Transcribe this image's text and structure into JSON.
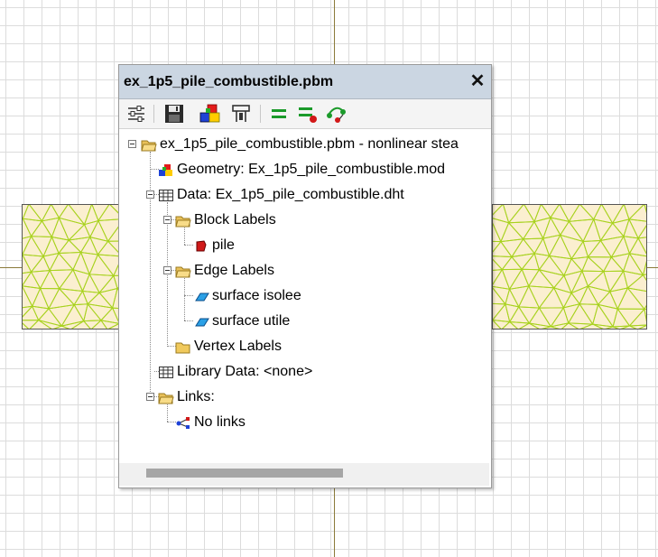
{
  "window": {
    "title": "ex_1p5_pile_combustible.pbm"
  },
  "icons": {
    "close": "close-icon",
    "toolbar": [
      "properties-icon",
      "save-icon",
      "geometry-icon",
      "clamp-icon",
      "equals-icon",
      "equals-red-icon",
      "link-nodes-icon"
    ]
  },
  "tree": {
    "root": "ex_1p5_pile_combustible.pbm - nonlinear stea",
    "geometry": "Geometry: Ex_1p5_pile_combustible.mod",
    "data": "Data: Ex_1p5_pile_combustible.dht",
    "block_labels": "Block Labels",
    "pile": "pile",
    "edge_labels": "Edge Labels",
    "surface_isolee": "surface isolee",
    "surface_utile": "surface utile",
    "vertex_labels": "Vertex Labels",
    "library_data": "Library Data: <none>",
    "links": "Links:",
    "no_links": "No links"
  },
  "colors": {
    "titlebar": "#cbd6e2",
    "mesh_fill": "#fbefd0",
    "mesh_line": "#a8d21e",
    "axis": "#8b7b3a"
  }
}
